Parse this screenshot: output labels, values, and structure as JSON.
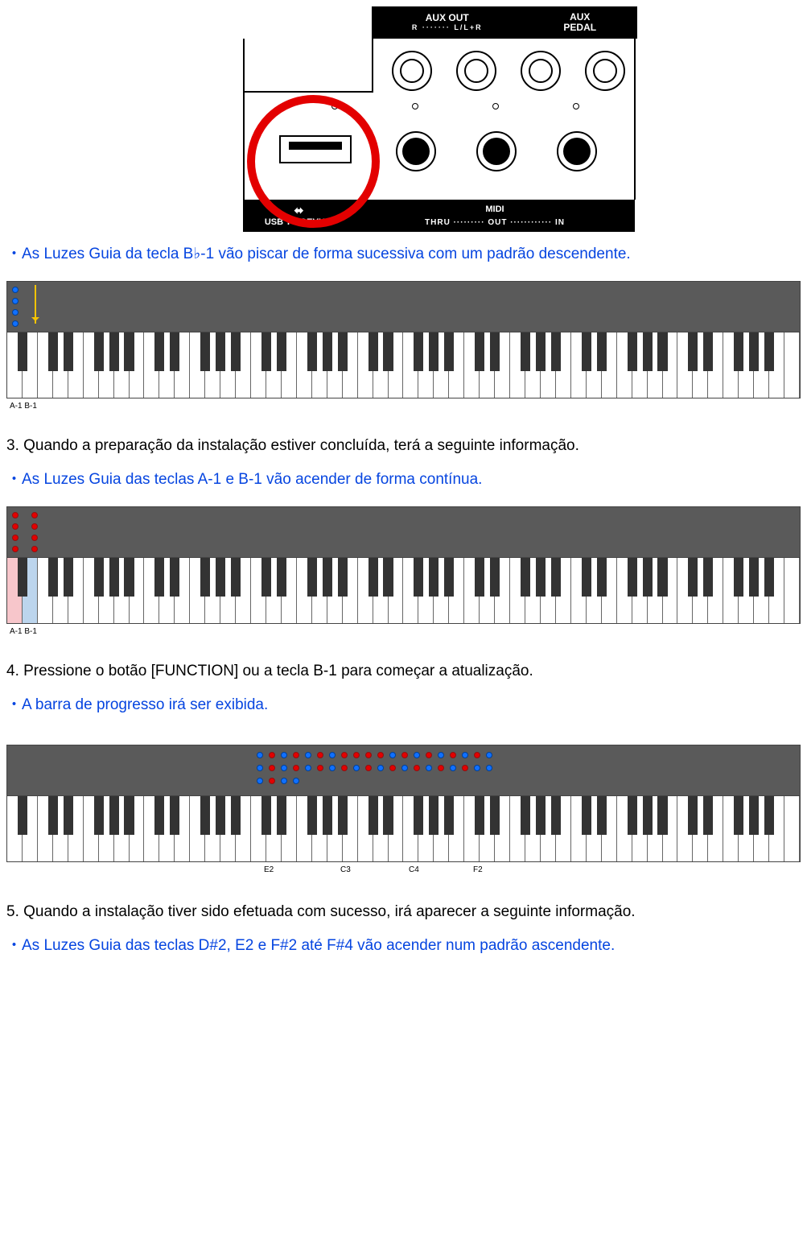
{
  "panel": {
    "top_aux_out": "AUX OUT",
    "top_aux_sub": "R ······· L/L+R",
    "top_pedal": "AUX\nPEDAL",
    "bottom_usb_sym": "⁂",
    "bottom_usb": "USB TO DEVICE",
    "bottom_midi": "MIDI",
    "bottom_midi_sub": "THRU ········· OUT ············ IN"
  },
  "text1": "・As Luzes Guia da tecla B♭-1 vão piscar de forma sucessiva com um padrão descendente.",
  "axis1": "A-1 B-1",
  "step3": "3. Quando a preparação da instalação estiver concluída, terá a seguinte informação.",
  "text2": "・As Luzes Guia das teclas A-1 e B-1 vão acender de forma contínua.",
  "axis2": "A-1 B-1",
  "step4": "4. Pressione o botão [FUNCTION] ou a tecla B-1 para começar a atualização.",
  "text3": "・A barra de progresso irá ser exibida.",
  "axis3": {
    "E2": "E2",
    "C3": "C3",
    "C4": "C4",
    "F2": "F2"
  },
  "step5": "5. Quando a instalação tiver sido efetuada com sucesso, irá aparecer a seguinte informação.",
  "text4": "・As Luzes Guia das teclas D#2, E2 e F#2 até F#4 vão acender num padrão ascendente.",
  "keyboard": {
    "white_keys": 52,
    "black_pattern_note": "standard 88-key starting at A-1; 36 black keys"
  }
}
